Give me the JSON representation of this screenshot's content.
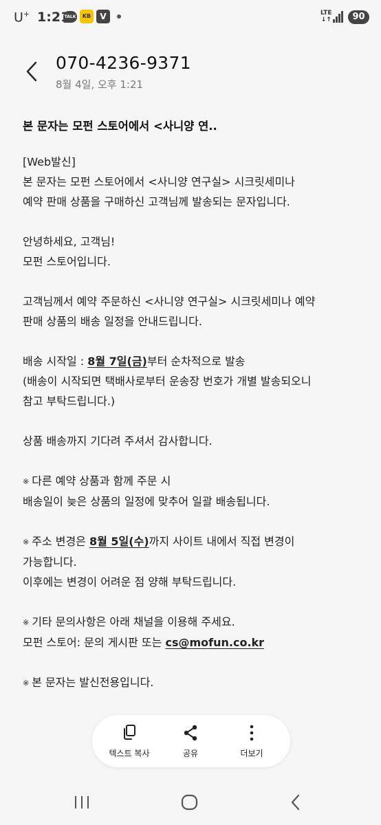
{
  "status_bar": {
    "carrier": "U",
    "carrier_sup": "+",
    "time": "1:21",
    "talk_label": "TALK",
    "kb_label": "KB",
    "v_label": "V",
    "network": "LTE",
    "battery": "90"
  },
  "header": {
    "phone": "070-4236-9371",
    "date": "8월 4일, 오후 1:21"
  },
  "message": {
    "subject": "본 문자는 모펀 스토어에서 <사니양 연..",
    "p1": [
      "[Web발신]",
      "본 문자는 모펀 스토어에서 <사니양 연구실> 시크릿세미나",
      "예약 판매 상품을 구매하신 고객님께 발송되는 문자입니다."
    ],
    "p2": [
      "안녕하세요, 고객님!",
      "모펀 스토어입니다."
    ],
    "p3": [
      "고객님께서 예약 주문하신 <사니양 연구실> 시크릿세미나 예약",
      "판매 상품의 배송 일정을 안내드립니다."
    ],
    "p4_pre": "배송 시작일 : ",
    "p4_hl": "8월 7일(금)",
    "p4_post": "부터 순차적으로 발송",
    "p4_lines": [
      "(배송이 시작되면 택배사로부터 운송장 번호가 개별 발송되오니",
      "참고 부탁드립니다.)"
    ],
    "p5": "상품 배송까지 기다려 주셔서 감사합니다.",
    "reference_mark": "※",
    "p6": [
      "다른 예약 상품과 함께 주문 시",
      "배송일이 늦은 상품의 일정에 맞추어 일괄 배송됩니다."
    ],
    "p7_pre": "주소 변경은 ",
    "p7_hl": "8월 5일(수)",
    "p7_post": "까지 사이트 내에서 직접 변경이",
    "p7_lines": [
      "가능합니다.",
      "이후에는 변경이 어려운 점 양해 부탁드립니다."
    ],
    "p8": "기타 문의사항은 아래 채널을 이용해 주세요.",
    "p8_contact_pre": "모펀 스토어: 문의 게시판 또는 ",
    "p8_email": "cs@mofun.co.kr",
    "p9": "본 문자는 발신전용입니다."
  },
  "actions": {
    "copy_label": "텍스트 복사",
    "share_label": "공유",
    "more_label": "더보기"
  }
}
